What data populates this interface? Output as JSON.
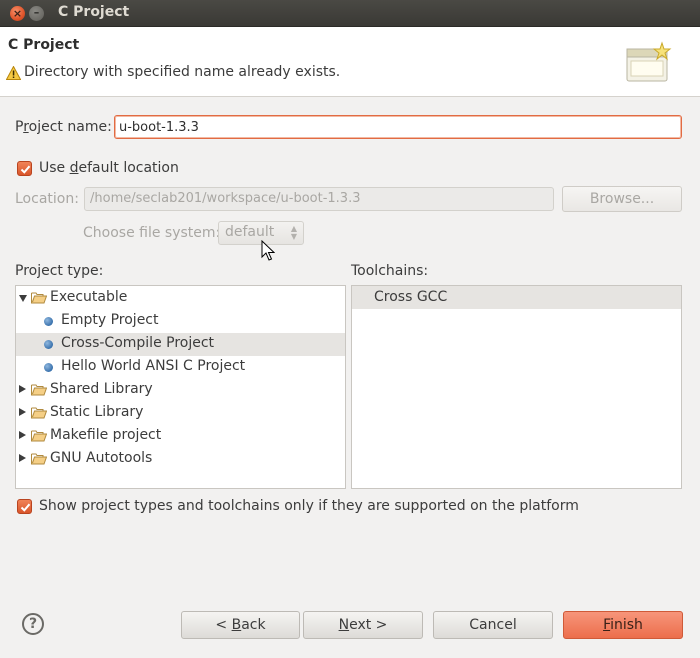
{
  "window": {
    "title": "C Project"
  },
  "header": {
    "title": "C Project",
    "message": "Directory with specified name already exists."
  },
  "project_name": {
    "label_pre": "P",
    "label_ul": "r",
    "label_post": "oject name:",
    "value": "u-boot-1.3.3"
  },
  "use_default_location": {
    "label_pre": "Use ",
    "label_ul": "d",
    "label_post": "efault location",
    "checked": true
  },
  "location": {
    "label": "Location:",
    "value": "/home/seclab201/workspace/u-boot-1.3.3",
    "browse_label": "Browse..."
  },
  "file_system": {
    "label": "Choose file system:",
    "value": "default"
  },
  "project_type": {
    "label": "Project type:",
    "items": [
      {
        "label": "Executable",
        "kind": "folder",
        "expanded": true,
        "level": 0
      },
      {
        "label": "Empty Project",
        "kind": "leaf",
        "level": 1
      },
      {
        "label": "Cross-Compile Project",
        "kind": "leaf",
        "level": 1,
        "selected": true
      },
      {
        "label": "Hello World ANSI C Project",
        "kind": "leaf",
        "level": 1
      },
      {
        "label": "Shared Library",
        "kind": "folder",
        "expanded": false,
        "level": 0
      },
      {
        "label": "Static Library",
        "kind": "folder",
        "expanded": false,
        "level": 0
      },
      {
        "label": "Makefile project",
        "kind": "folder",
        "expanded": false,
        "level": 0
      },
      {
        "label": "GNU Autotools",
        "kind": "folder",
        "expanded": false,
        "level": 0
      }
    ]
  },
  "toolchains": {
    "label": "Toolchains:",
    "items": [
      "Cross GCC"
    ]
  },
  "show_supported": {
    "label": "Show project types and toolchains only if they are supported on the platform",
    "checked": true
  },
  "buttons": {
    "help": "?",
    "back": {
      "pre": "< ",
      "ul": "B",
      "post": "ack"
    },
    "next": {
      "pre": "",
      "ul": "N",
      "post": "ext >"
    },
    "cancel": "Cancel",
    "finish": {
      "pre": "",
      "ul": "F",
      "post": "inish"
    }
  },
  "colors": {
    "accent": "#e26b43",
    "finish": "#ec6e4c",
    "titlebar": "#3f3e3a"
  }
}
